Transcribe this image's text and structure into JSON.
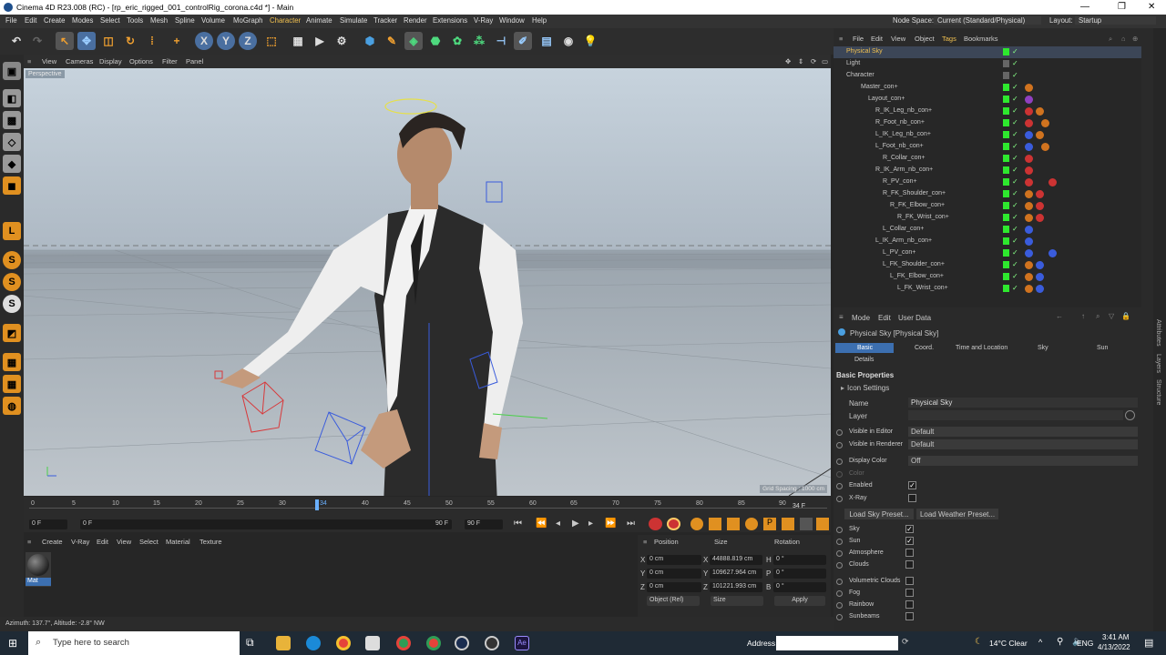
{
  "window": {
    "title": "Cinema 4D R23.008 (RC) - [rp_eric_rigged_001_controlRig_corona.c4d *] - Main"
  },
  "menu": [
    "File",
    "Edit",
    "Create",
    "Modes",
    "Select",
    "Tools",
    "Mesh",
    "Spline",
    "Volume",
    "MoGraph",
    "Character",
    "Animate",
    "Simulate",
    "Tracker",
    "Render",
    "Extensions",
    "V-Ray",
    "Window",
    "Help"
  ],
  "node_space": {
    "label": "Node Space:",
    "value": "Current (Standard/Physical)"
  },
  "layout": {
    "label": "Layout:",
    "value": "Startup"
  },
  "toolbar": {
    "axis_x": "X",
    "axis_y": "Y",
    "axis_z": "Z"
  },
  "viewport": {
    "menu": [
      "View",
      "Cameras",
      "Display",
      "Options",
      "Filter",
      "Panel"
    ],
    "label": "Perspective",
    "grid_spacing": "Grid Spacing : 1000 cm"
  },
  "timeline": {
    "ticks": [
      "0",
      "5",
      "10",
      "15",
      "20",
      "25",
      "30",
      "34",
      "40",
      "45",
      "50",
      "55",
      "60",
      "65",
      "70",
      "75",
      "80",
      "85",
      "90"
    ],
    "current_frame": "34 F",
    "start": "0 F",
    "min": "0 F",
    "max": "90 F",
    "end": "90 F"
  },
  "materials": {
    "menu": [
      "Create",
      "V-Ray",
      "Edit",
      "View",
      "Select",
      "Material",
      "Texture"
    ],
    "item_label": "Mat"
  },
  "coords": {
    "headers": [
      "Position",
      "Size",
      "Rotation"
    ],
    "rows": [
      {
        "axis": "X",
        "pos": "0 cm",
        "size_axis": "X",
        "size": "44888.819 cm",
        "rot_axis": "H",
        "rot": "0 °"
      },
      {
        "axis": "Y",
        "pos": "0 cm",
        "size_axis": "Y",
        "size": "109627.964 cm",
        "rot_axis": "P",
        "rot": "0 °"
      },
      {
        "axis": "Z",
        "pos": "0 cm",
        "size_axis": "Z",
        "size": "101221.993 cm",
        "rot_axis": "B",
        "rot": "0 °"
      }
    ],
    "mode": "Object (Rel)",
    "size_mode": "Size",
    "apply": "Apply"
  },
  "status": "Azimuth: 137.7°, Altitude: -2.8° NW",
  "objects": {
    "menu": [
      "File",
      "Edit",
      "View",
      "Object",
      "Tags",
      "Bookmarks"
    ],
    "items": [
      {
        "name": "Physical Sky",
        "indent": 0,
        "selected": true
      },
      {
        "name": "Light",
        "indent": 0
      },
      {
        "name": "Character",
        "indent": 0
      },
      {
        "name": "Master_con+",
        "indent": 1
      },
      {
        "name": "Layout_con+",
        "indent": 2
      },
      {
        "name": "R_IK_Leg_nb_con+",
        "indent": 3
      },
      {
        "name": "R_Foot_nb_con+",
        "indent": 3
      },
      {
        "name": "L_IK_Leg_nb_con+",
        "indent": 3
      },
      {
        "name": "L_Foot_nb_con+",
        "indent": 3
      },
      {
        "name": "R_Collar_con+",
        "indent": 4
      },
      {
        "name": "R_IK_Arm_nb_con+",
        "indent": 3
      },
      {
        "name": "R_PV_con+",
        "indent": 4
      },
      {
        "name": "R_FK_Shoulder_con+",
        "indent": 4
      },
      {
        "name": "R_FK_Elbow_con+",
        "indent": 5
      },
      {
        "name": "R_FK_Wrist_con+",
        "indent": 6
      },
      {
        "name": "L_Collar_con+",
        "indent": 4
      },
      {
        "name": "L_IK_Arm_nb_con+",
        "indent": 3
      },
      {
        "name": "L_PV_con+",
        "indent": 4
      },
      {
        "name": "L_FK_Shoulder_con+",
        "indent": 4
      },
      {
        "name": "L_FK_Elbow_con+",
        "indent": 5
      },
      {
        "name": "L_FK_Wrist_con+",
        "indent": 6
      }
    ]
  },
  "attributes": {
    "menu": [
      "Mode",
      "Edit",
      "User Data"
    ],
    "object_title": "Physical Sky [Physical Sky]",
    "tabs": [
      "Basic",
      "Coord.",
      "Time and Location",
      "Sky",
      "Sun",
      "Details"
    ],
    "section": "Basic Properties",
    "icon_settings": "Icon Settings",
    "name_label": "Name",
    "name_value": "Physical Sky",
    "layer_label": "Layer",
    "visible_editor_label": "Visible in Editor",
    "visible_editor": "Default",
    "visible_renderer_label": "Visible in Renderer",
    "visible_renderer": "Default",
    "display_color_label": "Display Color",
    "display_color": "Off",
    "color_label": "Color",
    "enabled_label": "Enabled",
    "xray_label": "X-Ray",
    "load_sky": "Load Sky Preset...",
    "load_weather": "Load Weather Preset...",
    "toggles": [
      {
        "label": "Sky",
        "checked": true
      },
      {
        "label": "Sun",
        "checked": true
      },
      {
        "label": "Atmosphere",
        "checked": false
      },
      {
        "label": "Clouds",
        "checked": false
      },
      {
        "label": "Volumetric Clouds",
        "checked": false
      },
      {
        "label": "Fog",
        "checked": false
      },
      {
        "label": "Rainbow",
        "checked": false
      },
      {
        "label": "Sunbeams",
        "checked": false
      }
    ]
  },
  "right_sidebar": [
    "Attributes",
    "Layers",
    "Structure"
  ],
  "taskbar": {
    "search_placeholder": "Type here to search",
    "address_label": "Address",
    "weather": "14°C  Clear",
    "lang": "ENG",
    "time": "3:41 AM",
    "date": "4/13/2022"
  },
  "colors": {
    "accent": "#3c6fb0",
    "visibility_green": "#2ee82e",
    "tag_orange": "#d0731f"
  }
}
